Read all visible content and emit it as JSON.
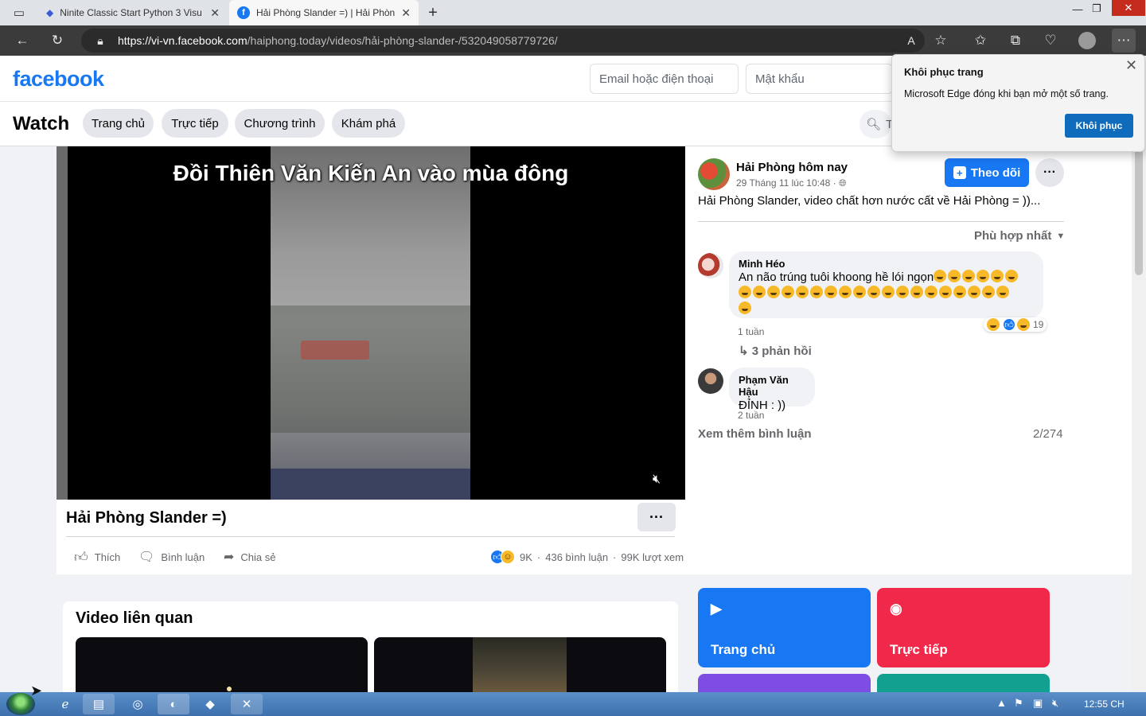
{
  "browser": {
    "tabs": [
      {
        "title": "Ninite Classic Start Python 3 Visu",
        "active": false
      },
      {
        "title": "Hải Phòng Slander =) | Hải Phòn",
        "active": true
      }
    ],
    "url_host": "https://vi-vn.facebook.com",
    "url_path": "/haiphong.today/videos/hải-phòng-slander-/532049058779726/"
  },
  "facebook": {
    "logo": "facebook",
    "email_placeholder": "Email hoặc điện thoại",
    "password_placeholder": "Mật khẩu"
  },
  "watch": {
    "title": "Watch",
    "nav": [
      "Trang chủ",
      "Trực tiếp",
      "Chương trình",
      "Khám phá"
    ],
    "search_placeholder": "T"
  },
  "video": {
    "caption": "Đồi Thiên Văn Kiến An vào mùa đông",
    "title": "Hải Phòng Slander =)",
    "actions": {
      "like": "Thích",
      "comment": "Bình luận",
      "share": "Chia sẻ"
    },
    "reaction_count": "9K",
    "comments_count": "436 bình luận",
    "views": "99K lượt xem",
    "stats_sep": "·"
  },
  "post": {
    "page_name": "Hải Phòng hôm nay",
    "date": "29 Tháng 11 lúc 10:48 ·",
    "follow_label": "Theo dõi",
    "text": "Hải Phòng Slander, video chất hơn nước cất về Hải Phòng = ))...",
    "sort_label": "Phù hợp nhất"
  },
  "comments": [
    {
      "author": "Minh Héo",
      "text": "An não trúng tuôi khoong hề lói ngọn",
      "emoji_count_line1": 6,
      "emoji_count_line2": 19,
      "emoji_count_line3": 1,
      "time": "1 tuần",
      "reactions": "19",
      "replies": "3 phản hồi"
    },
    {
      "author": "Phạm Văn Hậu",
      "text": "ĐỈNH : ))",
      "time": "2 tuần"
    }
  ],
  "see_more_comments": "Xem thêm bình luận",
  "comment_pagination": "2/274",
  "related": {
    "title": "Video liên quan"
  },
  "tiles": [
    {
      "label": "Trang chủ",
      "color": "#1877f2",
      "icon": "play-icon"
    },
    {
      "label": "Trực tiếp",
      "color": "#f02849",
      "icon": "live-camera-icon"
    }
  ],
  "popup": {
    "title": "Khôi phục trang",
    "body": "Microsoft Edge đóng khi bạn mở một số trang.",
    "button": "Khôi phục"
  },
  "taskbar": {
    "clock": "12:55 CH"
  }
}
